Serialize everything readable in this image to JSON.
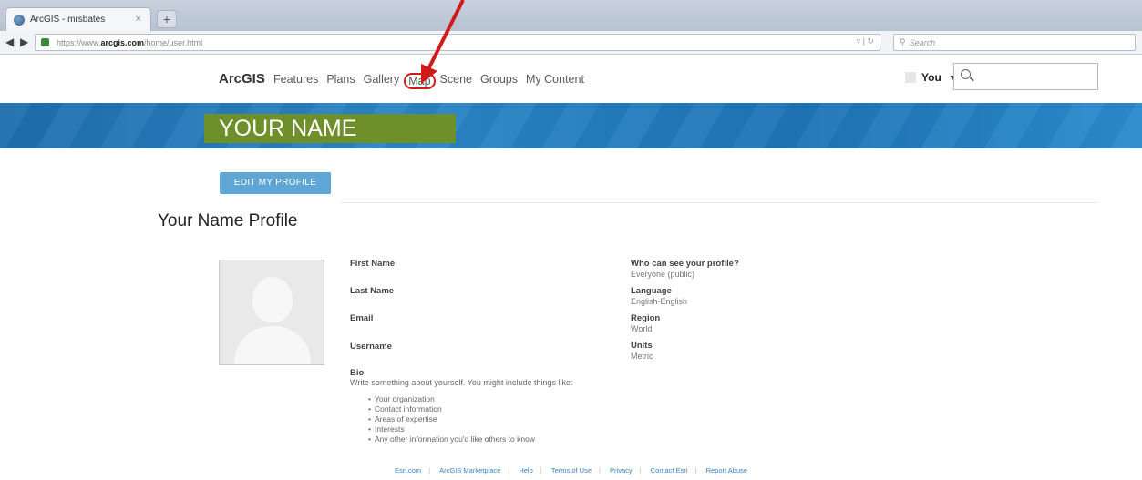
{
  "browser": {
    "tab_title": "ArcGIS - mrsbates",
    "tab_close": "×",
    "new_tab": "+",
    "url_prefix": "https://www.",
    "url_domain": "arcgis.com",
    "url_path": "/home/user.html",
    "search_placeholder": "Search"
  },
  "header": {
    "brand": "ArcGIS",
    "nav": [
      "Features",
      "Plans",
      "Gallery",
      "Map",
      "Scene",
      "Groups",
      "My Content"
    ],
    "user_label": "You",
    "highlighted_item": "Map",
    "annotation_color": "#d11a1a"
  },
  "banner": {
    "name": "YOUR NAME",
    "name_bg": "#6e8f2a",
    "banner_color": "#1f6fae"
  },
  "profile": {
    "edit_button": "EDIT MY PROFILE",
    "title": "Your Name Profile",
    "left_fields": [
      {
        "label": "First Name",
        "value": ""
      },
      {
        "label": "Last Name",
        "value": ""
      },
      {
        "label": "Email",
        "value": ""
      },
      {
        "label": "Username",
        "value": ""
      }
    ],
    "right_fields": [
      {
        "label": "Who can see your profile?",
        "value": "Everyone (public)"
      },
      {
        "label": "Language",
        "value": "English-English"
      },
      {
        "label": "Region",
        "value": "World"
      },
      {
        "label": "Units",
        "value": "Metric"
      }
    ],
    "bio_label": "Bio",
    "bio_prompt": "Write something about yourself. You might include things like:",
    "bio_items": [
      "Your organization",
      "Contact information",
      "Areas of expertise",
      "Interests",
      "Any other information you'd like others to know"
    ]
  },
  "footer": {
    "links": [
      "Esri.com",
      "ArcGIS Marketplace",
      "Help",
      "Terms of Use",
      "Privacy",
      "Contact Esri",
      "Report Abuse"
    ]
  }
}
